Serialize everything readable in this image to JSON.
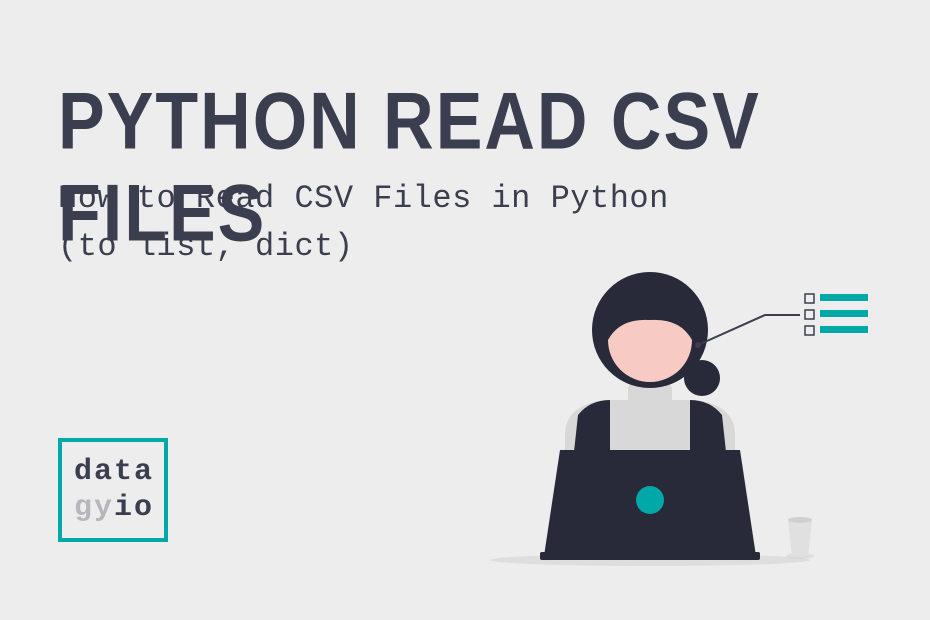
{
  "title": "PYTHON READ CSV FILES",
  "subtitle_line1": "How to Read CSV Files in Python",
  "subtitle_line2": "(to list, dict)",
  "logo": {
    "line1": "data",
    "gy": "gy",
    "io": "io"
  },
  "colors": {
    "background": "#ededed",
    "dark": "#3a3e4e",
    "teal": "#00a8a8",
    "face": "#f7cac3",
    "turtleneck": "#d8d8d8"
  }
}
